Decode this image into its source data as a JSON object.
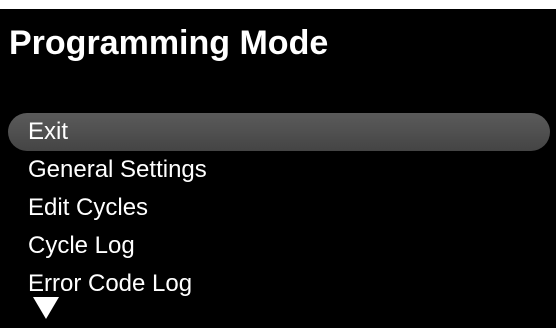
{
  "screen": {
    "title": "Programming Mode"
  },
  "menu": {
    "items": [
      {
        "label": "Exit",
        "selected": true
      },
      {
        "label": "General Settings",
        "selected": false
      },
      {
        "label": "Edit Cycles",
        "selected": false
      },
      {
        "label": "Cycle Log",
        "selected": false
      },
      {
        "label": "Error Code Log",
        "selected": false
      }
    ],
    "more_indicator_icon": "triangle-down-icon"
  },
  "colors": {
    "background": "#000000",
    "text": "#ffffff",
    "selection": "#505050"
  }
}
